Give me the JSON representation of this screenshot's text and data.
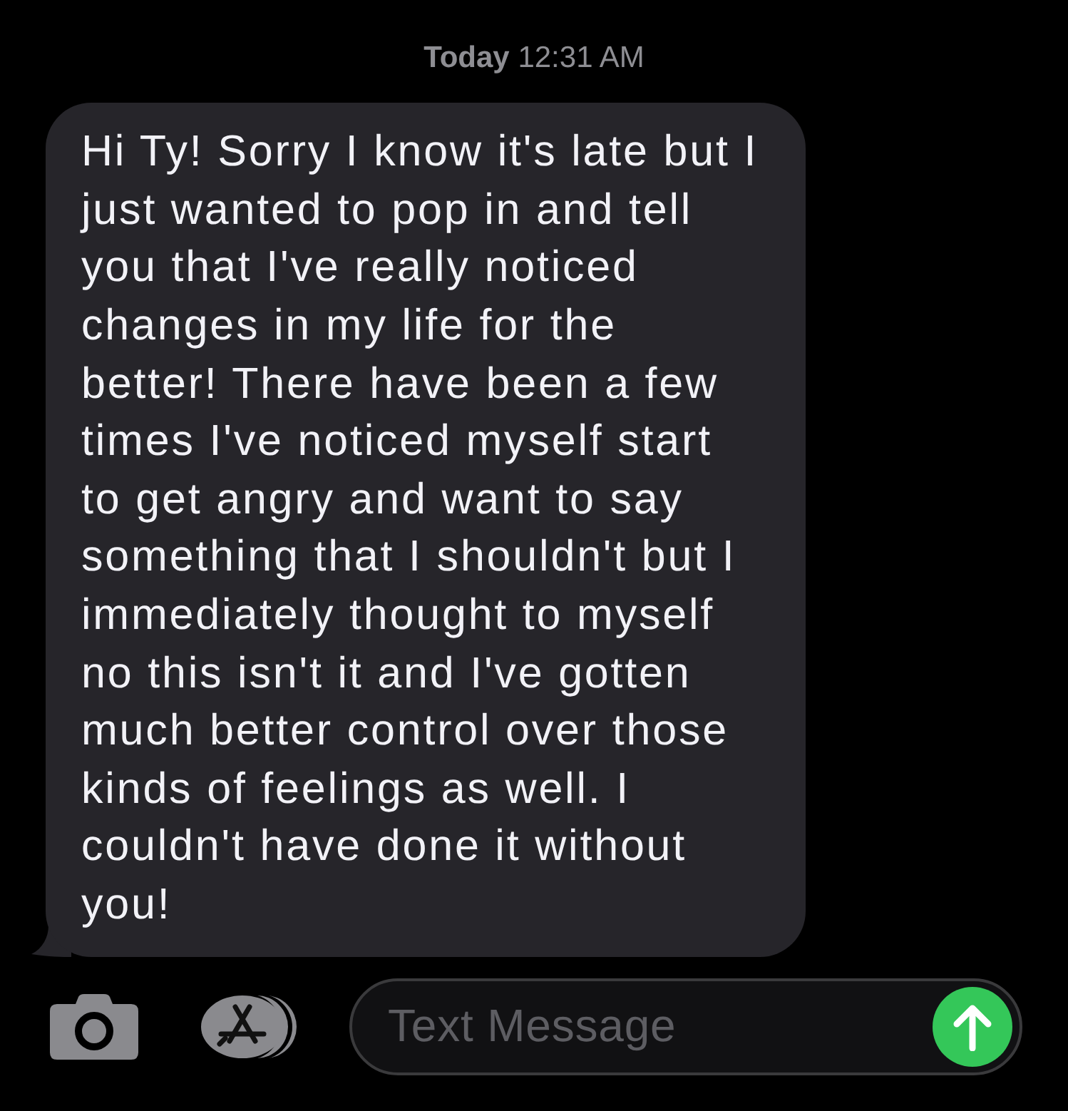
{
  "timestamp": "**Today** 12:31 AM",
  "messages": [
    {
      "kind": "received",
      "text": "Hi Ty! Sorry I know it's late but I just wanted to pop in and tell you that I've really noticed changes in my life for the better! There have been a few times I've noticed myself start to get angry and want to say something that I shouldn't but I immediately thought to myself no this isn't it and I've gotten much better control over those kinds of feelings as well. I couldn't have done it without you!"
    }
  ],
  "composer": {
    "placeholder": "Text Message"
  }
}
